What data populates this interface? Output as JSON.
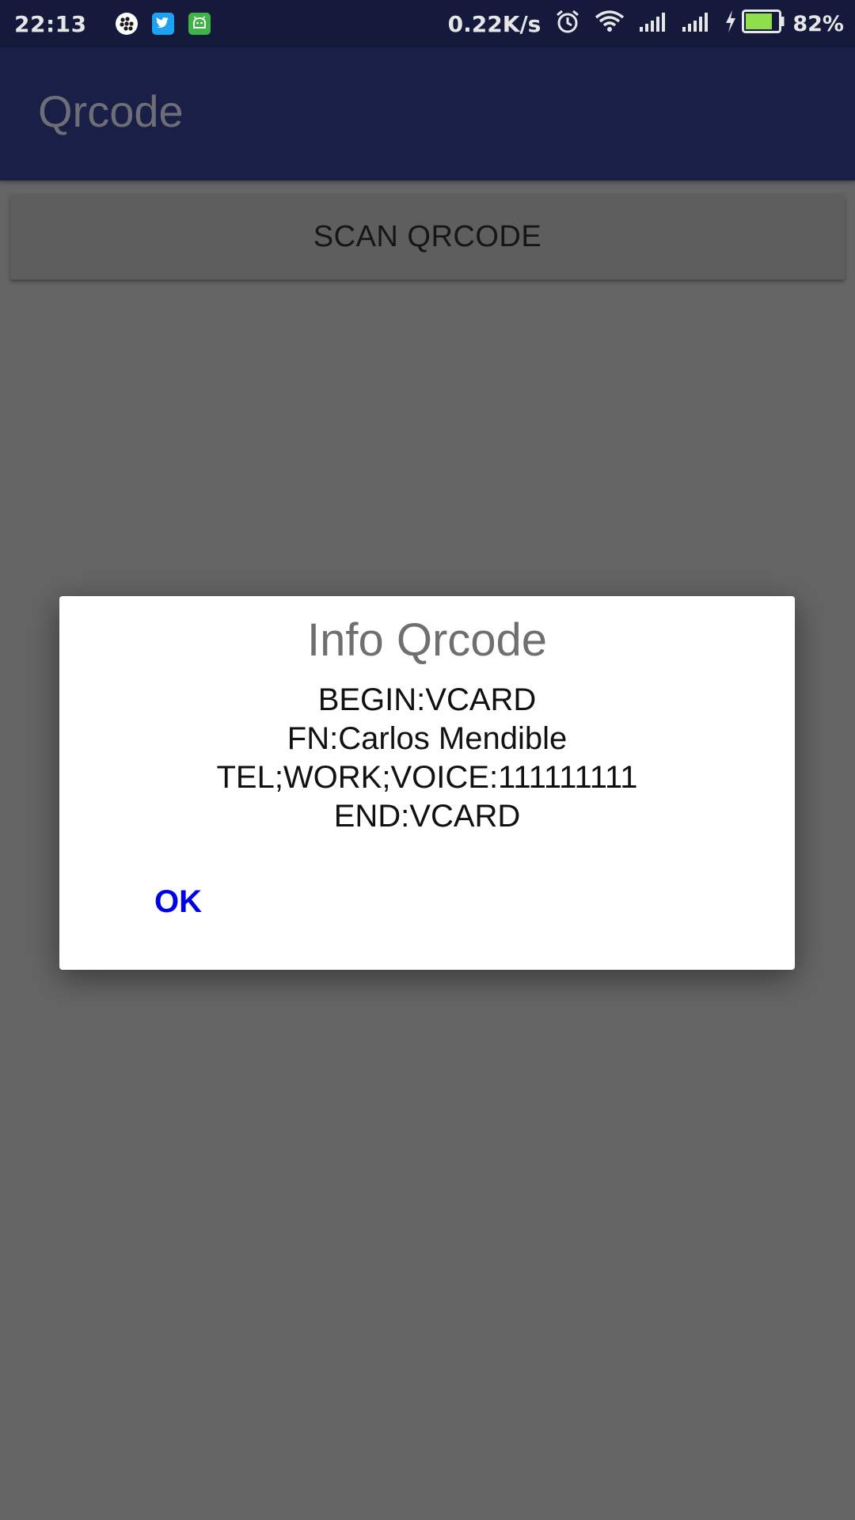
{
  "status_bar": {
    "time": "22:13",
    "notification_icons": [
      "bbm-icon",
      "twitter-icon",
      "android-app-icon"
    ],
    "net_speed": "0.22K/s",
    "right_icons": [
      "alarm-icon",
      "wifi-icon",
      "signal-icon",
      "signal-icon",
      "charging-icon",
      "battery-icon"
    ],
    "battery_percent": "82%",
    "battery_level": 0.82,
    "colors": {
      "background": "#151a3d",
      "battery_fill": "#8ee04a"
    }
  },
  "app_bar": {
    "title": "Qrcode",
    "background": "#1a1f48"
  },
  "main": {
    "scan_button_label": "SCAN QRCODE"
  },
  "dialog": {
    "title": "Info Qrcode",
    "message_lines": [
      "BEGIN:VCARD",
      "FN:Carlos Mendible",
      "TEL;WORK;VOICE:111111111",
      "END:VCARD"
    ],
    "ok_label": "OK",
    "ok_color": "#0000e6"
  }
}
